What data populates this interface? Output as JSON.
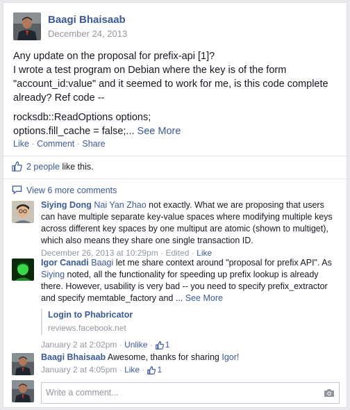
{
  "post": {
    "author": "Baagi Bhaisaab",
    "date": "December 24, 2013",
    "lines": [
      "Any update on the proposal for prefix-api [1]?",
      "I wrote a test program on Debian where the key is of the form \"account_id:value\" and it seemed to work for me, is this code complete already? Ref code --"
    ],
    "code_line1": "rocksdb::ReadOptions options;",
    "code_line2": "options.fill_cache = false;...",
    "see_more": "See More",
    "actions": {
      "like": "Like",
      "comment": "Comment",
      "share": "Share",
      "separator": "·"
    }
  },
  "likes": {
    "count_link": "2 people",
    "text": "like this."
  },
  "view_more": "View 6 more comments",
  "comments": [
    {
      "name": "Siying Dong",
      "mention": "Nai Yan Zhao",
      "text": "not exactly. What we are proposing that users can have multiple separate key-value spaces where modifying multiple keys across different key spaces by one multiput are atomic (shown to multiget), which also means they share one single transaction ID.",
      "time": "December 26, 2013 at 10:29pm",
      "edited": "Edited",
      "like": "Like"
    },
    {
      "name": "Igor Canadi",
      "mention": "Baagi",
      "text_a": "let me share context around \"proposal for prefix API\". As",
      "mention2": "Siying",
      "text_b": "noted, all the functionality for speeding up prefix lookup is already there. However, usability is very bad -- you need to specify prefix_extractor and specify memtable_factory and ...",
      "see_more": "See More",
      "share_title": "Login to Phabricator",
      "share_url": "reviews.facebook.net",
      "time": "January 2 at 2:02pm",
      "unlike": "Unlike",
      "like_count": "1"
    },
    {
      "name": "Baagi Bhaisaab",
      "text": "Awesome, thanks for sharing",
      "mention": "Igor!",
      "time": "January 2 at 4:05pm",
      "like": "Like",
      "like_count": "1"
    }
  ],
  "write_placeholder": "Write a comment...",
  "icons": {
    "thumb": "thumbs-up-icon",
    "comments": "comment-bubble-icon",
    "camera": "camera-icon"
  },
  "colors": {
    "link": "#3b5998",
    "meta": "#9197a3",
    "text": "#141823"
  }
}
